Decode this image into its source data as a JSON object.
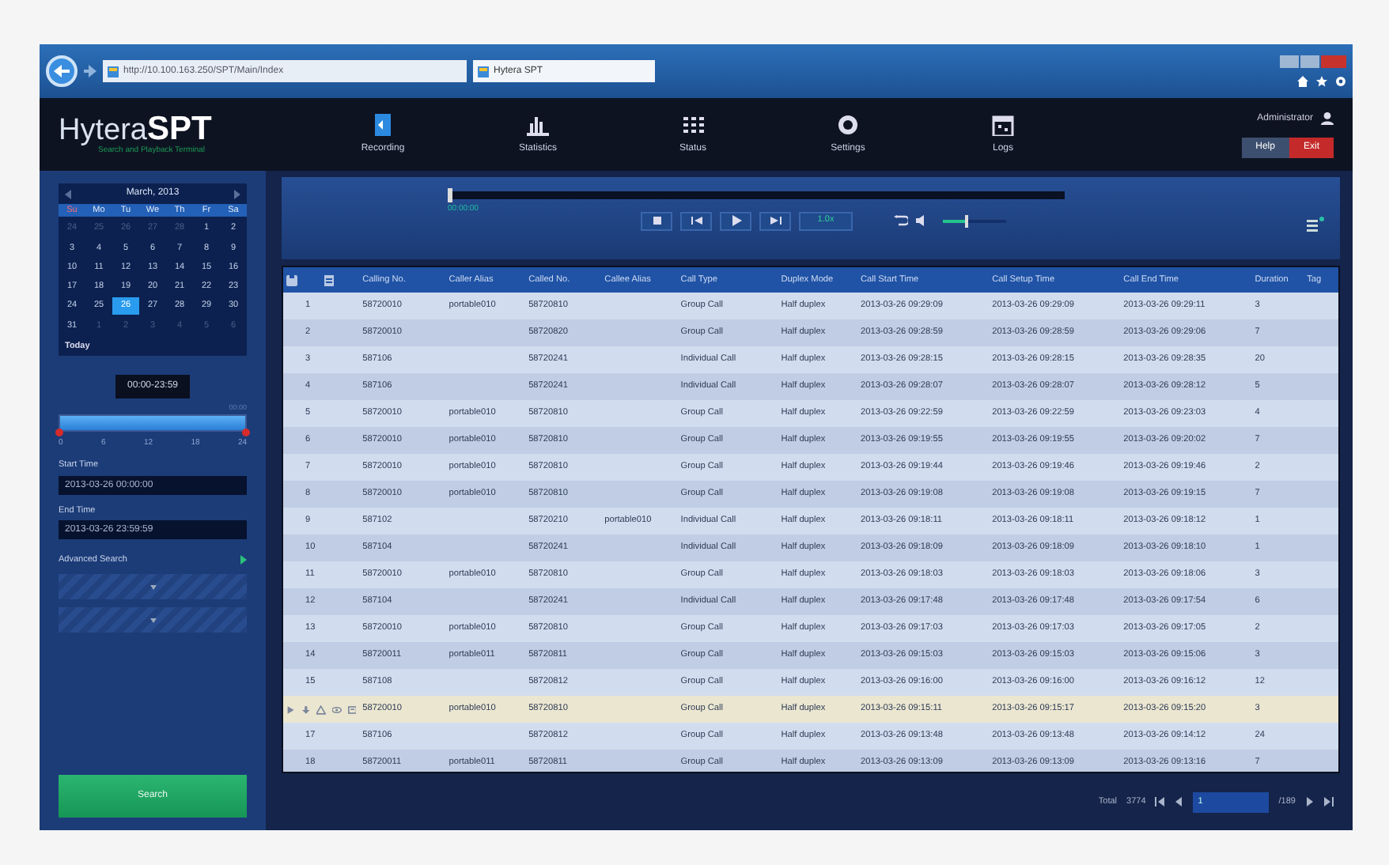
{
  "browser": {
    "address": "http://10.100.163.250/SPT/Main/Index",
    "tab_title": "Hytera SPT"
  },
  "header": {
    "logo_left": "Hytera",
    "logo_right": "SPT",
    "logo_subtitle": "Search and Playback Terminal",
    "nav": [
      {
        "label": "Recording",
        "selected": false
      },
      {
        "label": "Statistics",
        "selected": false
      },
      {
        "label": "Status",
        "selected": false
      },
      {
        "label": "Settings",
        "selected": false
      },
      {
        "label": "Logs",
        "selected": false
      }
    ],
    "user": "Administrator",
    "buttons": [
      {
        "label": "Help",
        "kind": "plain"
      },
      {
        "label": "Exit",
        "kind": "danger"
      }
    ]
  },
  "calendar": {
    "month": "March, 2013",
    "weekdays": [
      "Su",
      "Mo",
      "Tu",
      "We",
      "Th",
      "Fr",
      "Sa"
    ],
    "days": [
      {
        "d": "24",
        "muted": true,
        "selected": false
      },
      {
        "d": "25",
        "muted": true,
        "selected": false
      },
      {
        "d": "26",
        "muted": true,
        "selected": false
      },
      {
        "d": "27",
        "muted": true,
        "selected": false
      },
      {
        "d": "28",
        "muted": true,
        "selected": false
      },
      {
        "d": "1",
        "muted": false,
        "selected": false
      },
      {
        "d": "2",
        "muted": false,
        "selected": false
      },
      {
        "d": "3",
        "muted": false,
        "selected": false
      },
      {
        "d": "4",
        "muted": false,
        "selected": false
      },
      {
        "d": "5",
        "muted": false,
        "selected": false
      },
      {
        "d": "6",
        "muted": false,
        "selected": false
      },
      {
        "d": "7",
        "muted": false,
        "selected": false
      },
      {
        "d": "8",
        "muted": false,
        "selected": false
      },
      {
        "d": "9",
        "muted": false,
        "selected": false
      },
      {
        "d": "10",
        "muted": false,
        "selected": false
      },
      {
        "d": "11",
        "muted": false,
        "selected": false
      },
      {
        "d": "12",
        "muted": false,
        "selected": false
      },
      {
        "d": "13",
        "muted": false,
        "selected": false
      },
      {
        "d": "14",
        "muted": false,
        "selected": false
      },
      {
        "d": "15",
        "muted": false,
        "selected": false
      },
      {
        "d": "16",
        "muted": false,
        "selected": false
      },
      {
        "d": "17",
        "muted": false,
        "selected": false
      },
      {
        "d": "18",
        "muted": false,
        "selected": false
      },
      {
        "d": "19",
        "muted": false,
        "selected": false
      },
      {
        "d": "20",
        "muted": false,
        "selected": false
      },
      {
        "d": "21",
        "muted": false,
        "selected": false
      },
      {
        "d": "22",
        "muted": false,
        "selected": false
      },
      {
        "d": "23",
        "muted": false,
        "selected": false
      },
      {
        "d": "24",
        "muted": false,
        "selected": false
      },
      {
        "d": "25",
        "muted": false,
        "selected": false
      },
      {
        "d": "26",
        "muted": false,
        "selected": true
      },
      {
        "d": "27",
        "muted": false,
        "selected": false
      },
      {
        "d": "28",
        "muted": false,
        "selected": false
      },
      {
        "d": "29",
        "muted": false,
        "selected": false
      },
      {
        "d": "30",
        "muted": false,
        "selected": false
      },
      {
        "d": "31",
        "muted": false,
        "selected": false
      },
      {
        "d": "1",
        "muted": true,
        "selected": false
      },
      {
        "d": "2",
        "muted": true,
        "selected": false
      },
      {
        "d": "3",
        "muted": true,
        "selected": false
      },
      {
        "d": "4",
        "muted": true,
        "selected": false
      },
      {
        "d": "5",
        "muted": true,
        "selected": false
      },
      {
        "d": "6",
        "muted": true,
        "selected": false
      }
    ],
    "today": "Today"
  },
  "time_range": {
    "level": 1,
    "bubble": "00:00-23:59",
    "corner": "00:00",
    "ticks": [
      "0",
      "6",
      "12",
      "18",
      "24"
    ]
  },
  "fields": [
    {
      "label": "Start Time",
      "value": "2013-03-26 00:00:00"
    },
    {
      "label": "End Time",
      "value": "2013-03-26 23:59:59"
    }
  ],
  "advanced_search": "Advanced Search",
  "search_button": "Search",
  "player": {
    "progress": {
      "level": 0
    },
    "time": "00:00:00",
    "speed": "1.0x",
    "volume": {
      "level": 0.35
    }
  },
  "table": {
    "columns": [
      "Calling No.",
      "Caller Alias",
      "Called No.",
      "Callee Alias",
      "Call Type",
      "Duplex Mode",
      "Call Start Time",
      "Call Setup Time",
      "Call End Time",
      "Duration",
      "Tag"
    ],
    "rows": [
      {
        "no": "1",
        "selected": false,
        "cells": [
          "58720010",
          "portable010",
          "58720810",
          "",
          "Group Call",
          "Half duplex",
          "2013-03-26 09:29:09",
          "2013-03-26 09:29:09",
          "2013-03-26 09:29:11",
          "3",
          ""
        ]
      },
      {
        "no": "2",
        "selected": false,
        "cells": [
          "58720010",
          "",
          "58720820",
          "",
          "Group Call",
          "Half duplex",
          "2013-03-26 09:28:59",
          "2013-03-26 09:28:59",
          "2013-03-26 09:29:06",
          "7",
          ""
        ]
      },
      {
        "no": "3",
        "selected": false,
        "cells": [
          "587106",
          "",
          "58720241",
          "",
          "Individual Call",
          "Half duplex",
          "2013-03-26 09:28:15",
          "2013-03-26 09:28:15",
          "2013-03-26 09:28:35",
          "20",
          ""
        ]
      },
      {
        "no": "4",
        "selected": false,
        "cells": [
          "587106",
          "",
          "58720241",
          "",
          "Individual Call",
          "Half duplex",
          "2013-03-26 09:28:07",
          "2013-03-26 09:28:07",
          "2013-03-26 09:28:12",
          "5",
          ""
        ]
      },
      {
        "no": "5",
        "selected": false,
        "cells": [
          "58720010",
          "portable010",
          "58720810",
          "",
          "Group Call",
          "Half duplex",
          "2013-03-26 09:22:59",
          "2013-03-26 09:22:59",
          "2013-03-26 09:23:03",
          "4",
          ""
        ]
      },
      {
        "no": "6",
        "selected": false,
        "cells": [
          "58720010",
          "portable010",
          "58720810",
          "",
          "Group Call",
          "Half duplex",
          "2013-03-26 09:19:55",
          "2013-03-26 09:19:55",
          "2013-03-26 09:20:02",
          "7",
          ""
        ]
      },
      {
        "no": "7",
        "selected": false,
        "cells": [
          "58720010",
          "portable010",
          "58720810",
          "",
          "Group Call",
          "Half duplex",
          "2013-03-26 09:19:44",
          "2013-03-26 09:19:46",
          "2013-03-26 09:19:46",
          "2",
          ""
        ]
      },
      {
        "no": "8",
        "selected": false,
        "cells": [
          "58720010",
          "portable010",
          "58720810",
          "",
          "Group Call",
          "Half duplex",
          "2013-03-26 09:19:08",
          "2013-03-26 09:19:08",
          "2013-03-26 09:19:15",
          "7",
          ""
        ]
      },
      {
        "no": "9",
        "selected": false,
        "cells": [
          "587102",
          "",
          "58720210",
          "portable010",
          "Individual Call",
          "Half duplex",
          "2013-03-26 09:18:11",
          "2013-03-26 09:18:11",
          "2013-03-26 09:18:12",
          "1",
          ""
        ]
      },
      {
        "no": "10",
        "selected": false,
        "cells": [
          "587104",
          "",
          "58720241",
          "",
          "Individual Call",
          "Half duplex",
          "2013-03-26 09:18:09",
          "2013-03-26 09:18:09",
          "2013-03-26 09:18:10",
          "1",
          ""
        ]
      },
      {
        "no": "11",
        "selected": false,
        "cells": [
          "58720010",
          "portable010",
          "58720810",
          "",
          "Group Call",
          "Half duplex",
          "2013-03-26 09:18:03",
          "2013-03-26 09:18:03",
          "2013-03-26 09:18:06",
          "3",
          ""
        ]
      },
      {
        "no": "12",
        "selected": false,
        "cells": [
          "587104",
          "",
          "58720241",
          "",
          "Individual Call",
          "Half duplex",
          "2013-03-26 09:17:48",
          "2013-03-26 09:17:48",
          "2013-03-26 09:17:54",
          "6",
          ""
        ]
      },
      {
        "no": "13",
        "selected": false,
        "cells": [
          "58720010",
          "portable010",
          "58720810",
          "",
          "Group Call",
          "Half duplex",
          "2013-03-26 09:17:03",
          "2013-03-26 09:17:03",
          "2013-03-26 09:17:05",
          "2",
          ""
        ]
      },
      {
        "no": "14",
        "selected": false,
        "cells": [
          "58720011",
          "portable011",
          "58720811",
          "",
          "Group Call",
          "Half duplex",
          "2013-03-26 09:15:03",
          "2013-03-26 09:15:03",
          "2013-03-26 09:15:06",
          "3",
          ""
        ]
      },
      {
        "no": "15",
        "selected": false,
        "cells": [
          "587108",
          "",
          "58720812",
          "",
          "Group Call",
          "Half duplex",
          "2013-03-26 09:16:00",
          "2013-03-26 09:16:00",
          "2013-03-26 09:16:12",
          "12",
          ""
        ]
      },
      {
        "selected": true,
        "cells": [
          "58720010",
          "portable010",
          "58720810",
          "",
          "Group Call",
          "Half duplex",
          "2013-03-26 09:15:11",
          "2013-03-26 09:15:17",
          "2013-03-26 09:15:20",
          "3",
          ""
        ]
      },
      {
        "no": "17",
        "selected": false,
        "cells": [
          "587106",
          "",
          "58720812",
          "",
          "Group Call",
          "Half duplex",
          "2013-03-26 09:13:48",
          "2013-03-26 09:13:48",
          "2013-03-26 09:14:12",
          "24",
          ""
        ]
      },
      {
        "no": "18",
        "selected": false,
        "cells": [
          "58720011",
          "portable011",
          "58720811",
          "",
          "Group Call",
          "Half duplex",
          "2013-03-26 09:13:09",
          "2013-03-26 09:13:09",
          "2013-03-26 09:13:16",
          "7",
          ""
        ]
      }
    ]
  },
  "pager": {
    "total_label": "Total",
    "total": "3774",
    "page": "1",
    "pages": "/189"
  }
}
